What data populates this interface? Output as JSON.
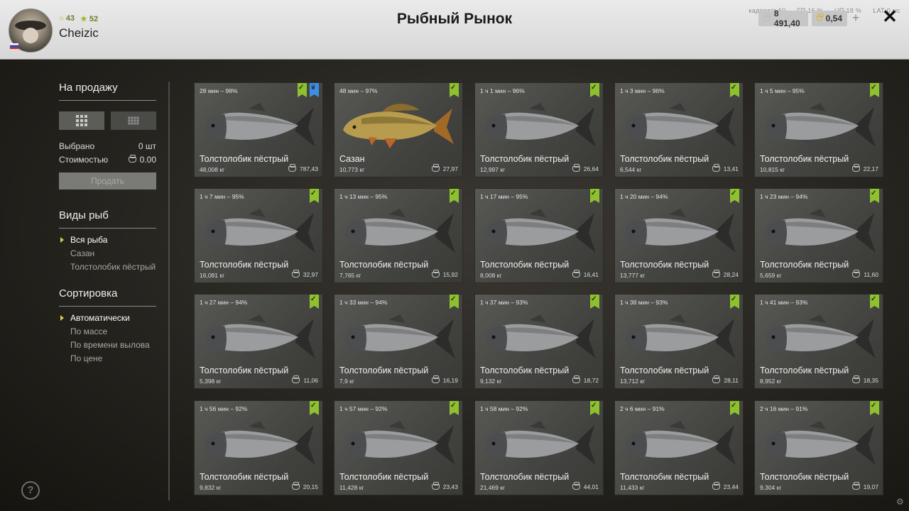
{
  "header": {
    "title": "Рыбный Рынок",
    "player_name": "Cheizic",
    "level": "43",
    "rank": "52",
    "level_icon": "ring-icon",
    "rank_icon": "star-icon",
    "system": {
      "fps_label": "кадров/с",
      "fps": "60",
      "gpu_label": "ГП",
      "gpu": "16 %",
      "cpu_label": "ЦП",
      "cpu": "18 %",
      "lat_label": "LAT",
      "lat": "0 мс"
    },
    "silver": "8 491,40",
    "gold": "0,54"
  },
  "sidebar": {
    "for_sale_title": "На продажу",
    "selected_label": "Выбрано",
    "selected_value": "0 шт",
    "cost_label": "Стоимостью",
    "cost_value": "0.00",
    "sell_button": "Продать",
    "fish_types_title": "Виды рыб",
    "fish_types": [
      "Вся рыба",
      "Сазан",
      "Толстолобик пёстрый"
    ],
    "sorting_title": "Сортировка",
    "sorting": [
      "Автоматически",
      "По массе",
      "По времени вылова",
      "По цене"
    ]
  },
  "colors": {
    "tag_green": "#8ec02f",
    "tag_blue": "#3c8fe0",
    "selected_marker": "#d6c94a"
  },
  "cards": [
    {
      "time": "28 мин – 98%",
      "name": "Толстолобик пёстрый",
      "weight": "48,008 кг",
      "price": "787,43",
      "fish": "bighead",
      "trophy": true
    },
    {
      "time": "48 мин – 97%",
      "name": "Сазан",
      "weight": "10,773 кг",
      "price": "27,97",
      "fish": "carp"
    },
    {
      "time": "1 ч 1 мин – 96%",
      "name": "Толстолобик пёстрый",
      "weight": "12,997 кг",
      "price": "26,64",
      "fish": "bighead"
    },
    {
      "time": "1 ч 3 мин – 96%",
      "name": "Толстолобик пёстрый",
      "weight": "6,544 кг",
      "price": "13,41",
      "fish": "bighead"
    },
    {
      "time": "1 ч 5 мин – 95%",
      "name": "Толстолобик пёстрый",
      "weight": "10,815 кг",
      "price": "22,17",
      "fish": "bighead"
    },
    {
      "time": "1 ч 7 мин – 95%",
      "name": "Толстолобик пёстрый",
      "weight": "16,081 кг",
      "price": "32,97",
      "fish": "bighead"
    },
    {
      "time": "1 ч 13 мин – 95%",
      "name": "Толстолобик пёстрый",
      "weight": "7,765 кг",
      "price": "15,92",
      "fish": "bighead"
    },
    {
      "time": "1 ч 17 мин – 95%",
      "name": "Толстолобик пёстрый",
      "weight": "8,008 кг",
      "price": "16,41",
      "fish": "bighead"
    },
    {
      "time": "1 ч 20 мин – 94%",
      "name": "Толстолобик пёстрый",
      "weight": "13,777 кг",
      "price": "28,24",
      "fish": "bighead"
    },
    {
      "time": "1 ч 23 мин – 94%",
      "name": "Толстолобик пёстрый",
      "weight": "5,659 кг",
      "price": "11,60",
      "fish": "bighead"
    },
    {
      "time": "1 ч 27 мин – 94%",
      "name": "Толстолобик пёстрый",
      "weight": "5,398 кг",
      "price": "11,06",
      "fish": "bighead"
    },
    {
      "time": "1 ч 33 мин – 94%",
      "name": "Толстолобик пёстрый",
      "weight": "7,9 кг",
      "price": "16,19",
      "fish": "bighead"
    },
    {
      "time": "1 ч 37 мин – 93%",
      "name": "Толстолобик пёстрый",
      "weight": "9,132 кг",
      "price": "18,72",
      "fish": "bighead"
    },
    {
      "time": "1 ч 38 мин – 93%",
      "name": "Толстолобик пёстрый",
      "weight": "13,712 кг",
      "price": "28,11",
      "fish": "bighead"
    },
    {
      "time": "1 ч 41 мин – 93%",
      "name": "Толстолобик пёстрый",
      "weight": "8,952 кг",
      "price": "18,35",
      "fish": "bighead"
    },
    {
      "time": "1 ч 56 мин – 92%",
      "name": "Толстолобик пёстрый",
      "weight": "9,832 кг",
      "price": "20,15",
      "fish": "bighead"
    },
    {
      "time": "1 ч 57 мин – 92%",
      "name": "Толстолобик пёстрый",
      "weight": "11,428 кг",
      "price": "23,43",
      "fish": "bighead"
    },
    {
      "time": "1 ч 58 мин – 92%",
      "name": "Толстолобик пёстрый",
      "weight": "21,469 кг",
      "price": "44,01",
      "fish": "bighead"
    },
    {
      "time": "2 ч 6 мин – 91%",
      "name": "Толстолобик пёстрый",
      "weight": "11,433 кг",
      "price": "23,44",
      "fish": "bighead"
    },
    {
      "time": "2 ч 16 мин – 91%",
      "name": "Толстолобик пёстрый",
      "weight": "9,304 кг",
      "price": "19,07",
      "fish": "bighead"
    }
  ]
}
